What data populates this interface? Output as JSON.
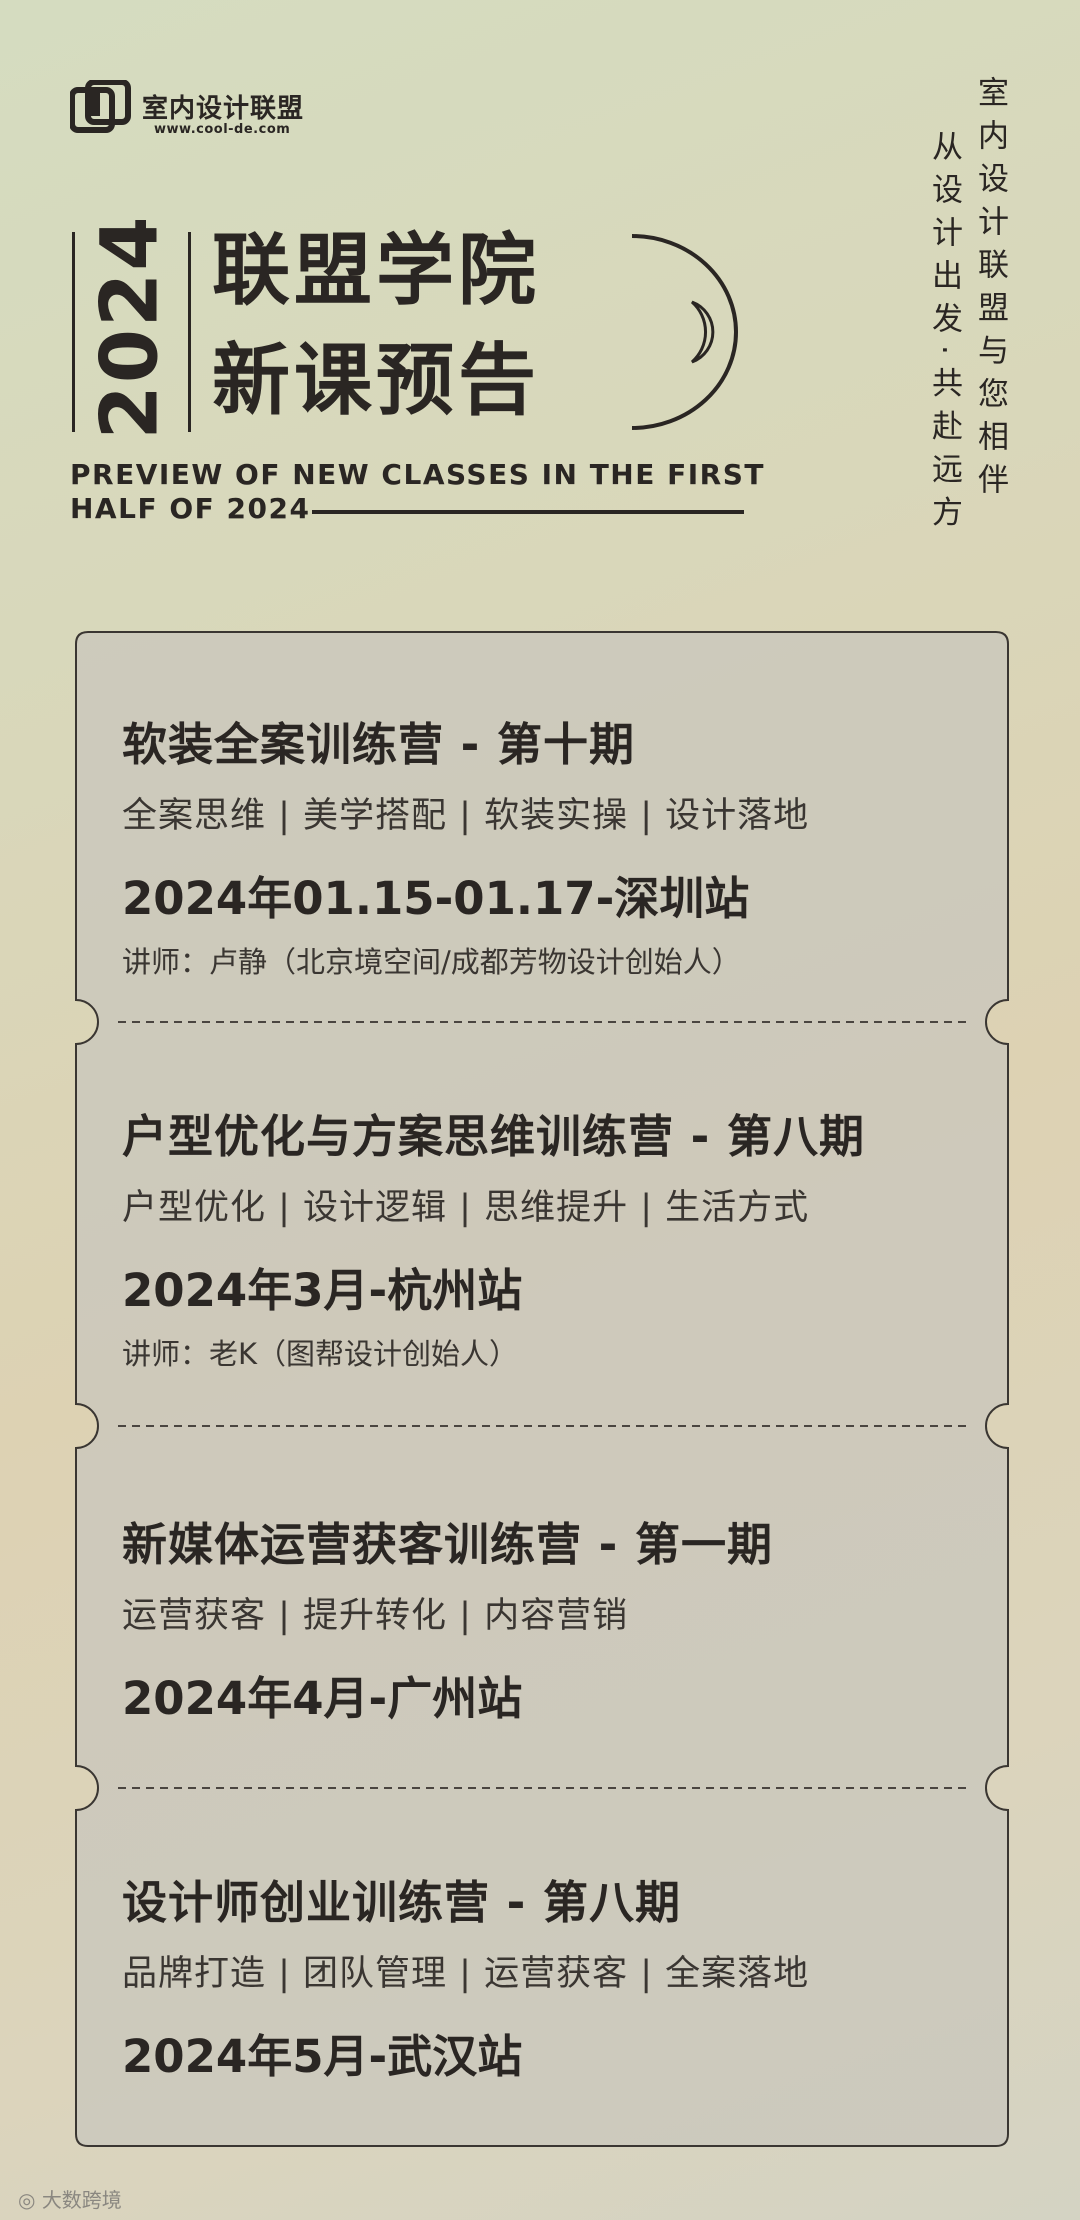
{
  "brand": {
    "name": "室内设计联盟",
    "url": "www.cool-de.com"
  },
  "header": {
    "year": "2024",
    "title_line1": "联盟学院",
    "title_line2": "新课预告",
    "english_line1": "PREVIEW OF NEW CLASSES IN THE FIRST",
    "english_line2": "HALF OF 2024"
  },
  "tagline": {
    "line1": "室内设计联盟与您相伴",
    "line2": "从设计出发·共赴远方"
  },
  "courses": [
    {
      "title": "软装全案训练营 - 第十期",
      "tags": "全案思维 | 美学搭配 | 软装实操 | 设计落地",
      "date": "2024年01.15-01.17-深圳站",
      "lecturer": "讲师：卢静（北京境空间/成都芳物设计创始人）"
    },
    {
      "title": "户型优化与方案思维训练营 - 第八期",
      "tags": "户型优化 | 设计逻辑 | 思维提升 | 生活方式",
      "date": "2024年3月-杭州站",
      "lecturer": "讲师：老K（图帮设计创始人）"
    },
    {
      "title": "新媒体运营获客训练营 - 第一期",
      "tags": "运营获客 | 提升转化 | 内容营销",
      "date": "2024年4月-广州站"
    },
    {
      "title": "设计师创业训练营 - 第八期",
      "tags": "品牌打造 | 团队管理 | 运营获客 | 全案落地",
      "date": "2024年5月-武汉站"
    }
  ],
  "watermark": "大数跨境",
  "colors": {
    "ink": "#2a2623",
    "card": "#c9c6bc",
    "card_border": "#3a3632"
  }
}
